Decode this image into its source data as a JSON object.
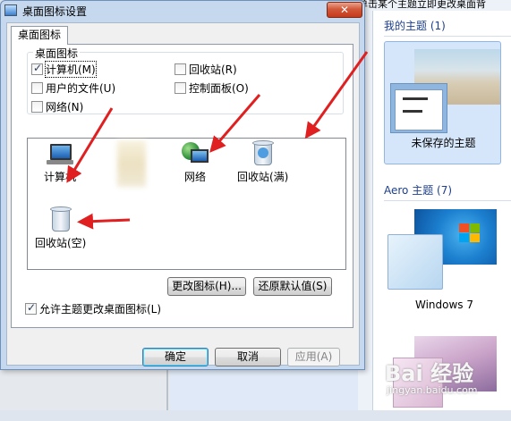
{
  "background_window": {
    "top_text": "单击某个主题立即更改桌面背",
    "my_themes_heading": "我的主题 (1)",
    "unsaved_theme_label": "未保存的主题",
    "aero_heading": "Aero 主题 (7)",
    "aero_theme_label": "Windows 7"
  },
  "dialog": {
    "title": "桌面图标设置",
    "close_glyph": "✕",
    "tab_label": "桌面图标",
    "group_title": "桌面图标",
    "checkboxes": [
      {
        "label": "计算机(M)",
        "checked": true
      },
      {
        "label": "用户的文件(U)",
        "checked": false
      },
      {
        "label": "网络(N)",
        "checked": false
      },
      {
        "label": "回收站(R)",
        "checked": false
      },
      {
        "label": "控制面板(O)",
        "checked": false
      }
    ],
    "icons": [
      {
        "label": "计算机"
      },
      {
        "label": "网络"
      },
      {
        "label": "回收站(满)"
      },
      {
        "label": "回收站(空)"
      }
    ],
    "change_icon_button": "更改图标(H)...",
    "restore_default_button": "还原默认值(S)",
    "allow_theme_checkbox": {
      "label": "允许主题更改桌面图标(L)",
      "checked": true
    },
    "ok_button": "确定",
    "cancel_button": "取消",
    "apply_button": "应用(A)"
  },
  "watermark": {
    "brand": "Bai 经验",
    "url": "jingyan.baidu.com"
  },
  "colors": {
    "arrow": "#e02020",
    "title_bar": "#c6d8ee",
    "close_button": "#c53a1a",
    "theme_heading": "#1e3f8a"
  }
}
